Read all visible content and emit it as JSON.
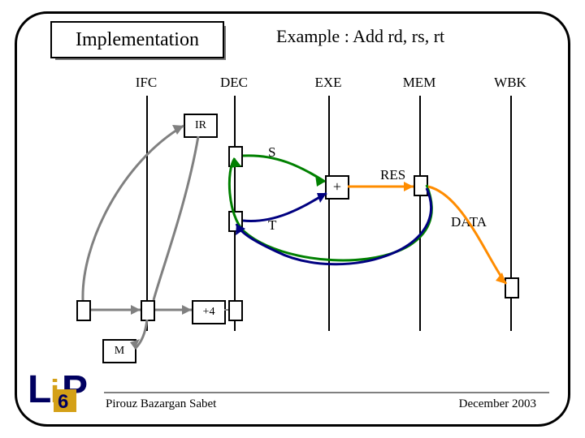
{
  "title": "Implementation",
  "subtitle": "Example : Add rd, rs, rt",
  "stages": {
    "ifc": "IFC",
    "dec": "DEC",
    "exe": "EXE",
    "mem": "MEM",
    "wbk": "WBK"
  },
  "nodes": {
    "ir": "IR",
    "s": "S",
    "t": "T",
    "res": "RES",
    "data": "DATA",
    "plus": "+",
    "plus4": "+4",
    "m": "M"
  },
  "footer": {
    "author": "Pirouz Bazargan Sabet",
    "date": "December 2003"
  },
  "logo": {
    "text_l": "L",
    "text_i": "i",
    "text_p": "P",
    "text_6": "6"
  },
  "colors": {
    "wire_s": "#008000",
    "wire_t": "#000080",
    "wire_res": "#ff8c00",
    "wire_pc": "#808080"
  }
}
